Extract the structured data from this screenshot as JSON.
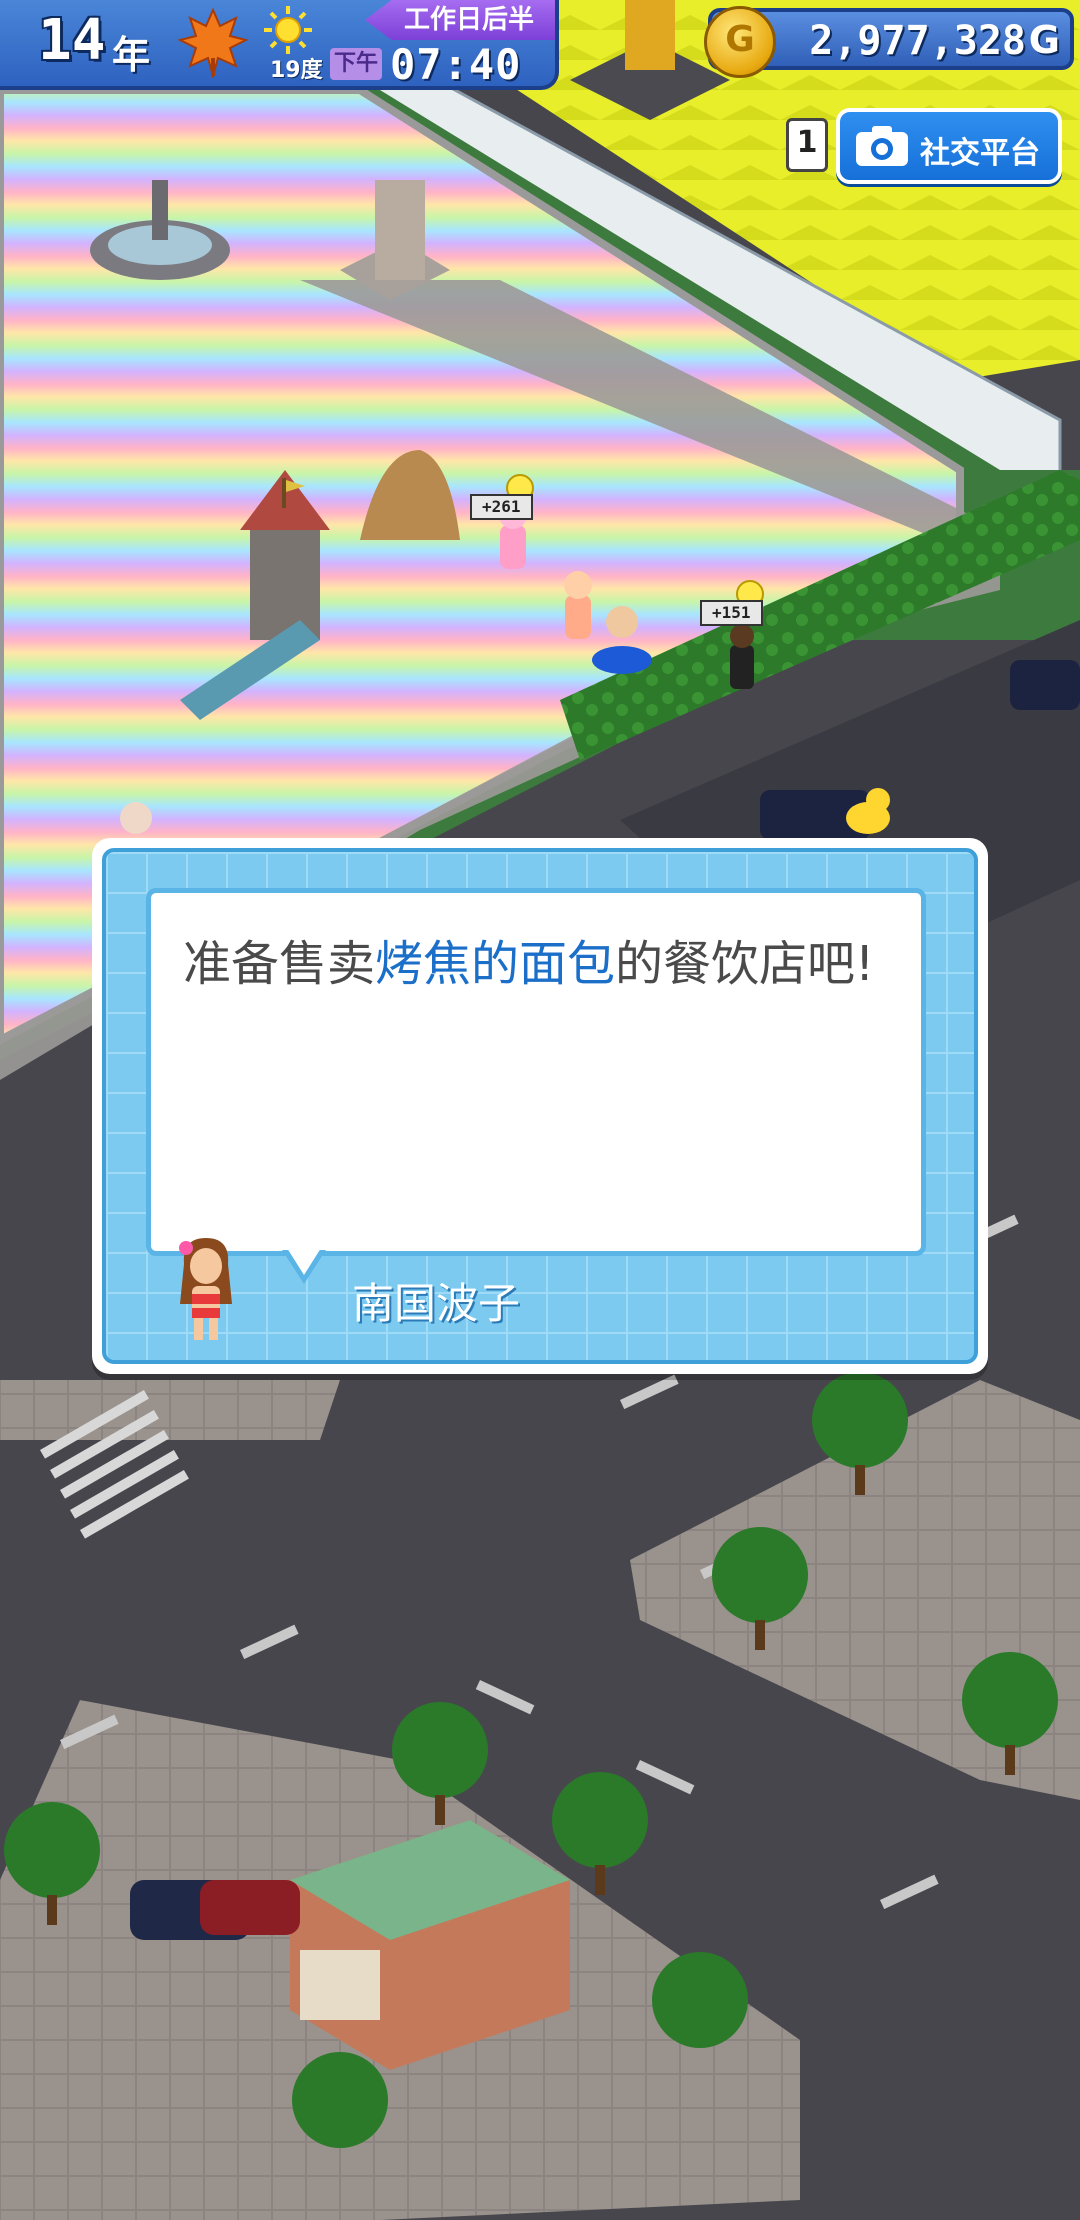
{
  "hud": {
    "year": "14",
    "year_unit": "年",
    "season_icon": "maple-leaf-icon",
    "weather_icon": "sun-icon",
    "temperature": "19度",
    "period": "工作日后半",
    "ampm": "下午",
    "time": "07:40",
    "money": "2,977,328",
    "money_unit": "G",
    "coin_icon": "gold-coin-icon"
  },
  "social": {
    "notification_count": "1",
    "icon": "camera-icon",
    "label": "社交平台"
  },
  "floating": {
    "bonus_1": "+261",
    "bonus_2": "+151"
  },
  "dialog": {
    "text_before": "准备售卖",
    "text_highlight": "烤焦的面包",
    "text_after": "的餐饮店吧!",
    "speaker": "南国波子",
    "colors": {
      "highlight": "#1b6fc8",
      "frame": "#7ccaf0",
      "text": "#4a4a4a"
    }
  }
}
